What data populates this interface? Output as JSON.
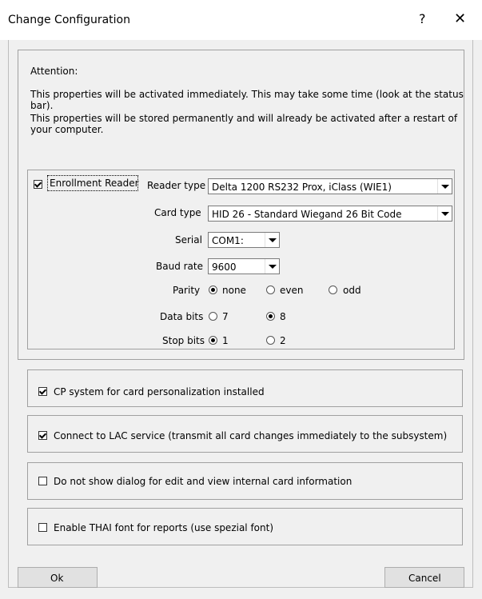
{
  "window": {
    "title": "Change Configuration",
    "help_glyph": "?",
    "close_glyph": "✕"
  },
  "info": {
    "heading": "Attention:",
    "line1": "This properties will be activated immediately. This may take some time (look at the status bar).",
    "line2": "This properties will be stored permanently and will already be activated after a restart of your computer."
  },
  "reader": {
    "enrollment_label": "Enrollment Reader",
    "enrollment_checked": true,
    "reader_type_label": "Reader type",
    "reader_type_value": "Delta 1200 RS232 Prox, iClass (WIE1)",
    "card_type_label": "Card type",
    "card_type_value": "HID 26 - Standard Wiegand 26 Bit Code",
    "serial_label": "Serial",
    "serial_value": "COM1:",
    "baud_label": "Baud rate",
    "baud_value": "9600",
    "parity_label": "Parity",
    "parity_options": [
      "none",
      "even",
      "odd"
    ],
    "parity_selected": "none",
    "databits_label": "Data bits",
    "databits_options": [
      "7",
      "8"
    ],
    "databits_selected": "8",
    "stopbits_label": "Stop bits",
    "stopbits_options": [
      "1",
      "2"
    ],
    "stopbits_selected": "1"
  },
  "options": {
    "cp_label": "CP system for card personalization installed",
    "cp_checked": true,
    "lac_label": "Connect to LAC service (transmit all card changes  immediately to the subsystem)",
    "lac_checked": true,
    "dialog_label": "Do not show dialog for edit and view internal card information",
    "dialog_checked": false,
    "thai_label": "Enable THAI font for reports (use spezial font)",
    "thai_checked": false
  },
  "buttons": {
    "ok": "Ok",
    "cancel": "Cancel"
  }
}
